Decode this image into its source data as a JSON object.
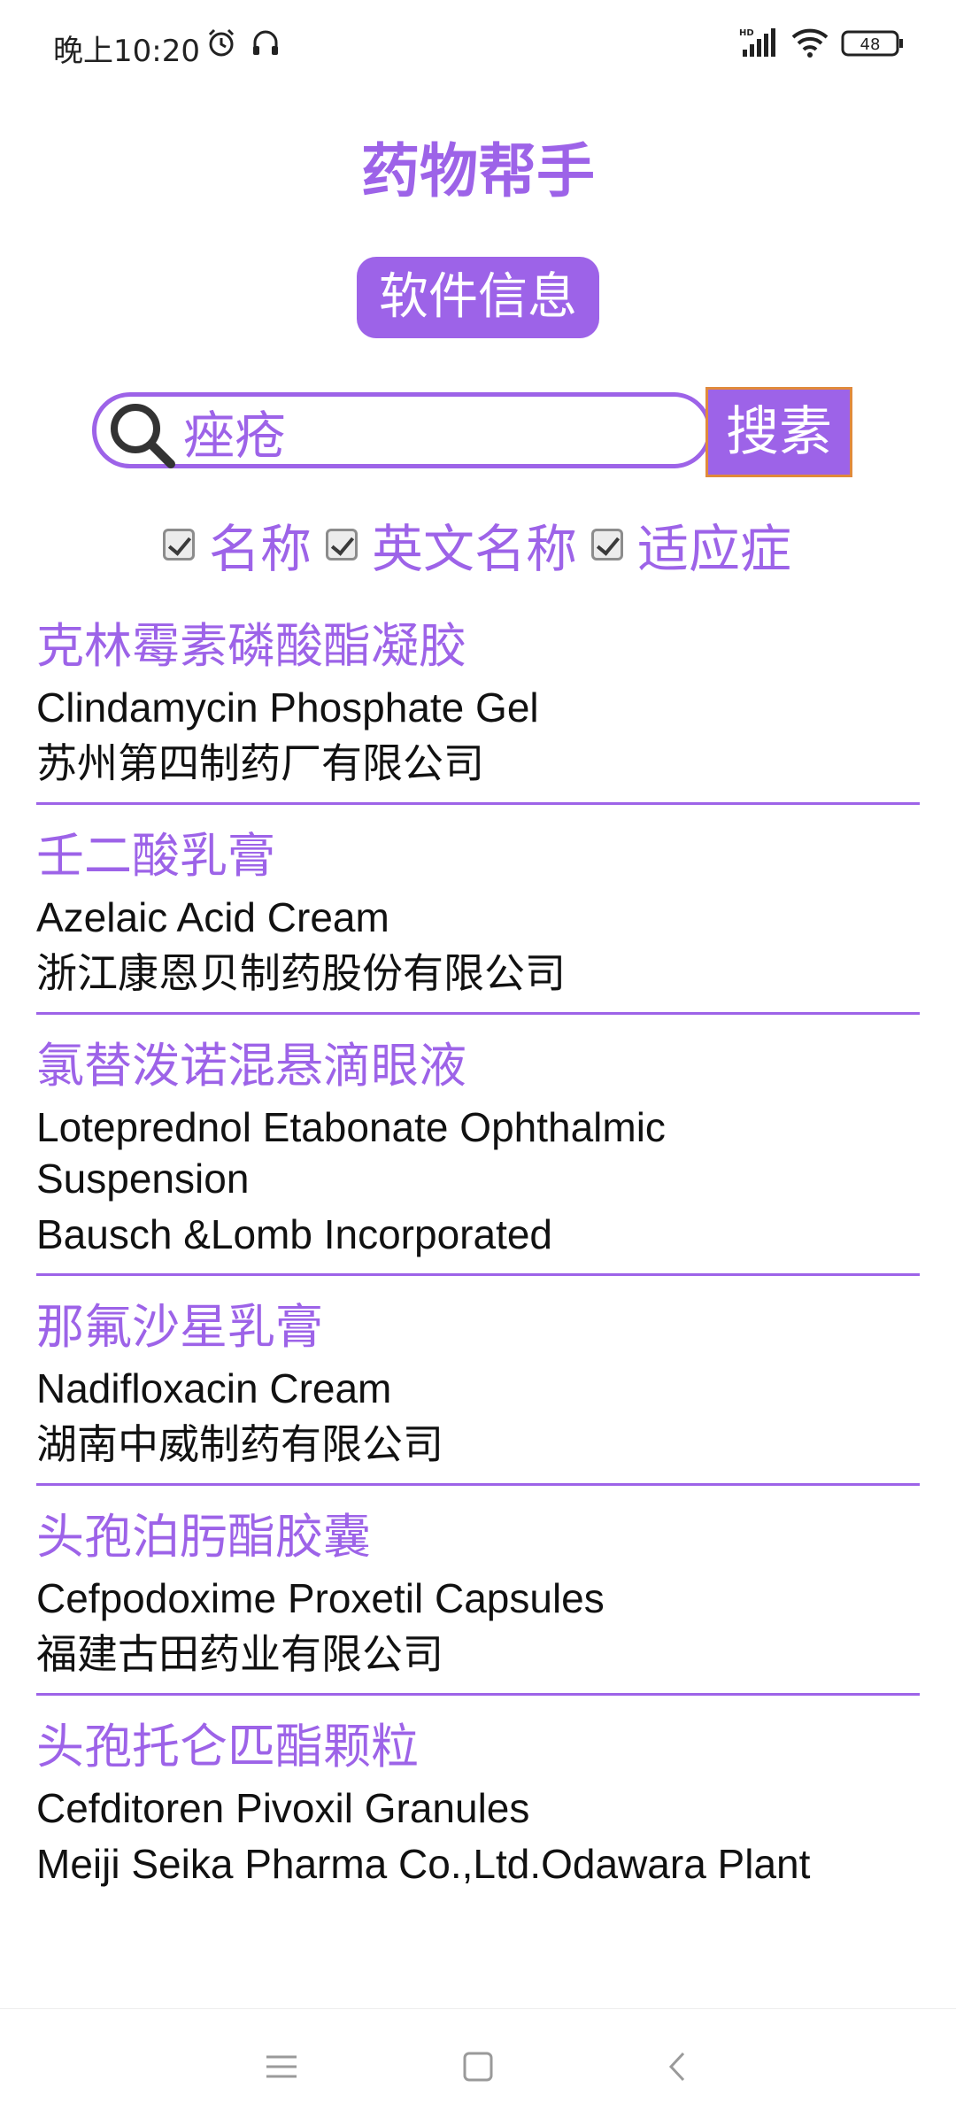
{
  "status_bar": {
    "time": "晚上10:20",
    "battery": "48",
    "icons": [
      "alarm-icon",
      "headphones-icon",
      "hd-signal-icon",
      "wifi-icon",
      "battery-icon"
    ]
  },
  "app": {
    "title": "药物帮手",
    "info_button": "软件信息"
  },
  "search": {
    "value": "痤疮",
    "button": "搜素"
  },
  "filters": [
    {
      "label": "名称",
      "checked": true
    },
    {
      "label": "英文名称",
      "checked": true
    },
    {
      "label": "适应症",
      "checked": true
    }
  ],
  "drugs": [
    {
      "name": "克林霉素磷酸酯凝胶",
      "english": "Clindamycin Phosphate Gel",
      "company": "苏州第四制药厂有限公司"
    },
    {
      "name": "壬二酸乳膏",
      "english": "Azelaic Acid Cream",
      "company": "浙江康恩贝制药股份有限公司"
    },
    {
      "name": "氯替泼诺混悬滴眼液",
      "english": "Loteprednol Etabonate Ophthalmic Suspension",
      "company": "Bausch &Lomb Incorporated"
    },
    {
      "name": "那氟沙星乳膏",
      "english": "Nadifloxacin Cream",
      "company": "湖南中威制药有限公司"
    },
    {
      "name": "头孢泊肟酯胶囊",
      "english": "Cefpodoxime Proxetil Capsules",
      "company": "福建古田药业有限公司"
    },
    {
      "name": "头孢托仑匹酯颗粒",
      "english": "Cefditoren Pivoxil Granules",
      "company": "Meiji Seika Pharma Co.,Ltd.Odawara Plant"
    }
  ],
  "colors": {
    "accent": "#9d63e8",
    "search_button_border": "#e08a3c",
    "text": "#111111"
  },
  "nav_bar": {
    "icons": [
      "menu-icon",
      "home-icon",
      "back-icon"
    ]
  }
}
